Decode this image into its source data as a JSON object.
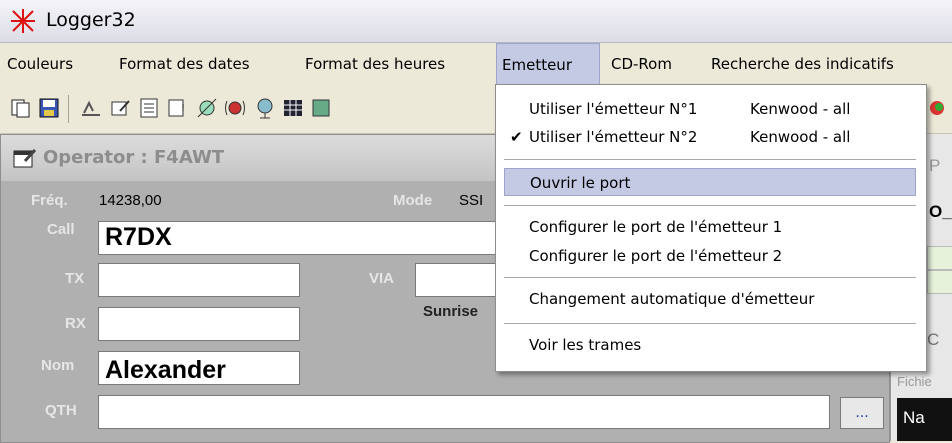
{
  "app": {
    "title": "Logger32"
  },
  "menubar": {
    "items": [
      {
        "label": "Couleurs"
      },
      {
        "label": "Format des dates"
      },
      {
        "label": "Format des heures"
      },
      {
        "label": "Emetteur"
      },
      {
        "label": "CD-Rom"
      },
      {
        "label": "Recherche des indicatifs"
      }
    ]
  },
  "toolbar": {
    "icons": [
      "copy-icon",
      "save-icon",
      "antenna-icon",
      "edit-icon",
      "list-icon",
      "print-icon",
      "satellite-icon",
      "radio-icon",
      "globe-icon",
      "grid-icon",
      "import-icon"
    ]
  },
  "operator_window": {
    "caption": "Operator : F4AWT",
    "freq_label": "Fréq.",
    "freq_value": "14238,00",
    "mode_label": "Mode",
    "mode_value": "SSI",
    "call_label": "Call",
    "call_value": "R7DX",
    "tx_label": "TX",
    "tx_value": "",
    "via_label": "VIA",
    "via_value": "",
    "rx_label": "RX",
    "rx_value": "",
    "sunrise_label": "Sunrise",
    "nom_label": "Nom",
    "nom_value": "Alexander",
    "qth_label": "QTH",
    "qth_value": "",
    "qth_button": "..."
  },
  "right_panel": {
    "top_label": "P",
    "call_fragment": "O_",
    "section_label": "C",
    "fichier_label": "Fichie",
    "na_label": "Na"
  },
  "dropdown": {
    "items": [
      {
        "label": "Utiliser l'émetteur N°1",
        "right": "Kenwood - all",
        "checked": false
      },
      {
        "label": "Utiliser l'émetteur N°2",
        "right": "Kenwood - all",
        "checked": true
      },
      {
        "label": "Ouvrir le port",
        "highlighted": true
      },
      {
        "label": "Configurer le port de l'émetteur 1"
      },
      {
        "label": "Configurer le port de l'émetteur 2"
      },
      {
        "label": "Changement automatique d'émetteur"
      },
      {
        "label": "Voir les trames"
      }
    ],
    "check_glyph": "✔"
  },
  "colors": {
    "highlight": "#c5cae4",
    "window_bg": "#b0b0b0",
    "menubar_bg": "#ece9d8"
  }
}
